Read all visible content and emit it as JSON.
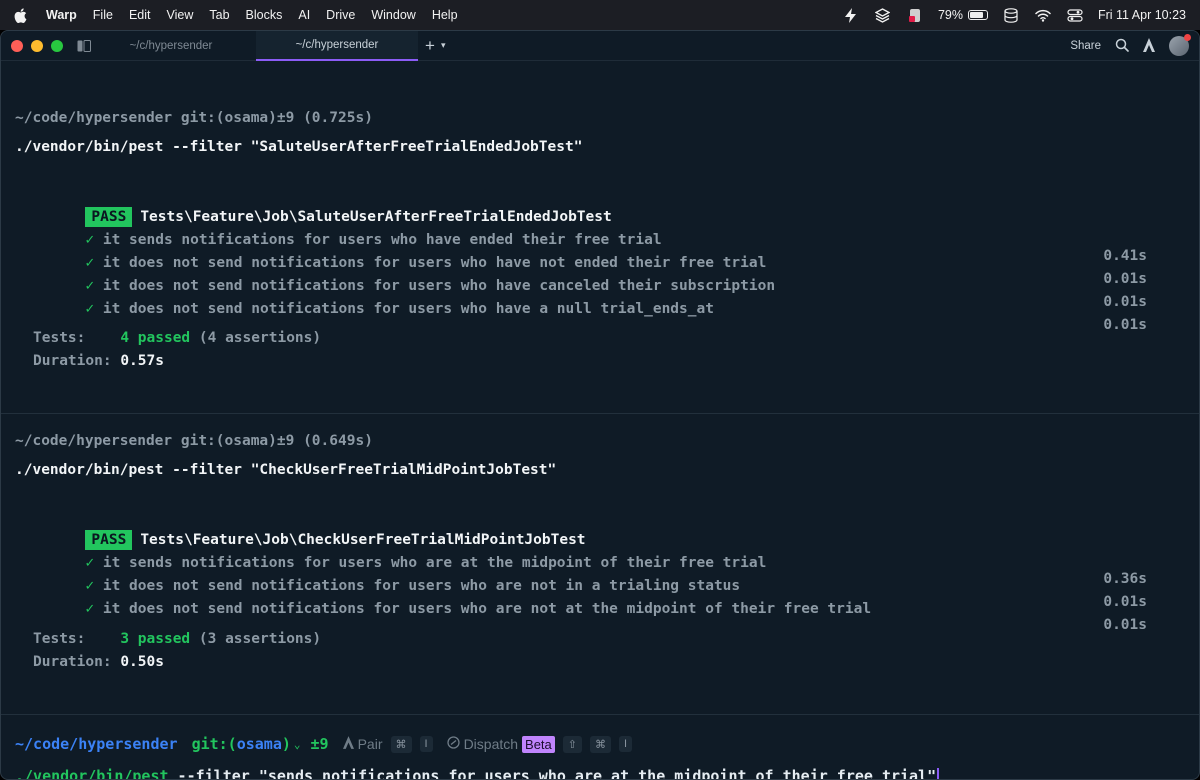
{
  "menubar": {
    "app": "Warp",
    "items": [
      "File",
      "Edit",
      "View",
      "Tab",
      "Blocks",
      "AI",
      "Drive",
      "Window",
      "Help"
    ],
    "battery": "79%",
    "battery_level": 0.79,
    "datetime": "Fri 11 Apr  10:23"
  },
  "tabs": [
    {
      "label": "~/c/hypersender"
    },
    {
      "label": "~/c/hypersender"
    }
  ],
  "toolbar": {
    "share": "Share"
  },
  "blocks": [
    {
      "prompt": "~/code/hypersender git:(osama)±9 (0.725s)",
      "command": "./vendor/bin/pest --filter \"SaluteUserAfterFreeTrialEndedJobTest\"",
      "badge": "PASS",
      "suite": "Tests\\Feature\\Job\\SaluteUserAfterFreeTrialEndedJobTest",
      "tests": [
        {
          "check": "✓",
          "name": "it sends notifications for users who have ended their free trial",
          "time": "0.41s"
        },
        {
          "check": "✓",
          "name": "it does not send notifications for users who have not ended their free trial",
          "time": "0.01s"
        },
        {
          "check": "✓",
          "name": "it does not send notifications for users who have canceled their subscription",
          "time": "0.01s"
        },
        {
          "check": "✓",
          "name": "it does not send notifications for users who have a null trial_ends_at",
          "time": "0.01s"
        }
      ],
      "tests_label": "Tests:",
      "passed": "4 passed",
      "assertions": "(4 assertions)",
      "duration_label": "Duration:",
      "duration": "0.57s"
    },
    {
      "prompt": "~/code/hypersender git:(osama)±9 (0.649s)",
      "command": "./vendor/bin/pest --filter \"CheckUserFreeTrialMidPointJobTest\"",
      "badge": "PASS",
      "suite": "Tests\\Feature\\Job\\CheckUserFreeTrialMidPointJobTest",
      "tests": [
        {
          "check": "✓",
          "name": "it sends notifications for users who are at the midpoint of their free trial",
          "time": "0.36s"
        },
        {
          "check": "✓",
          "name": "it does not send notifications for users who are not in a trialing status",
          "time": "0.01s"
        },
        {
          "check": "✓",
          "name": "it does not send notifications for users who are not at the midpoint of their free trial",
          "time": "0.01s"
        }
      ],
      "tests_label": "Tests:",
      "passed": "3 passed",
      "assertions": "(3 assertions)",
      "duration_label": "Duration:",
      "duration": "0.50s"
    }
  ],
  "input": {
    "path": "~/code/hypersender",
    "git": "git:(",
    "branch": "osama",
    "git_close": ")",
    "modified": "±9",
    "pair_label": "Pair",
    "pair_keys": [
      "⌘",
      "I"
    ],
    "dispatch_label": "Dispatch",
    "beta": "Beta",
    "dispatch_keys": [
      "⇧",
      "⌘",
      "I"
    ],
    "command_bin": "./vendor/bin/pest",
    "command_rest": " --filter \"sends notifications for users who are at the midpoint of their free trial\""
  }
}
